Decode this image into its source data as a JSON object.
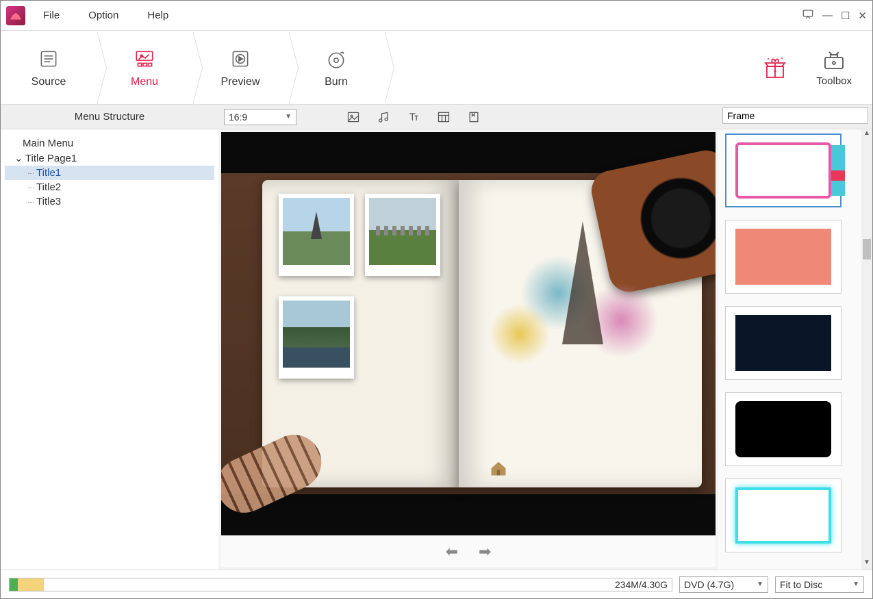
{
  "menubar": {
    "file": "File",
    "option": "Option",
    "help": "Help"
  },
  "steps": {
    "source": "Source",
    "menu": "Menu",
    "preview": "Preview",
    "burn": "Burn",
    "toolbox": "Toolbox"
  },
  "left_panel": {
    "header": "Menu Structure",
    "tree": {
      "main": "Main Menu",
      "page": "Title Page1",
      "t1": "Title1",
      "t2": "Title2",
      "t3": "Title3"
    }
  },
  "center": {
    "ratio": "16:9"
  },
  "right": {
    "search": "Frame"
  },
  "status": {
    "size": "234M/4.30G",
    "disc": "DVD (4.7G)",
    "fit": "Fit to Disc"
  }
}
